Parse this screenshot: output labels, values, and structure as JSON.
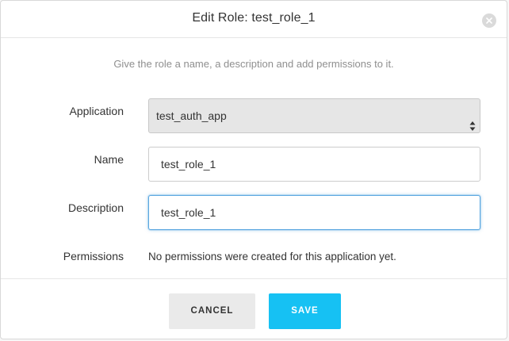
{
  "dialog": {
    "title": "Edit Role: test_role_1",
    "subtitle": "Give the role a name, a description and add permissions to it."
  },
  "form": {
    "application": {
      "label": "Application",
      "selected": "test_auth_app"
    },
    "name": {
      "label": "Name",
      "value": "test_role_1"
    },
    "description": {
      "label": "Description",
      "value": "test_role_1"
    },
    "permissions": {
      "label": "Permissions",
      "text": "No permissions were created for this application yet."
    }
  },
  "footer": {
    "cancel_label": "CANCEL",
    "save_label": "SAVE"
  },
  "colors": {
    "accent": "#16c1f3",
    "focus_border": "#5aa7e0"
  }
}
